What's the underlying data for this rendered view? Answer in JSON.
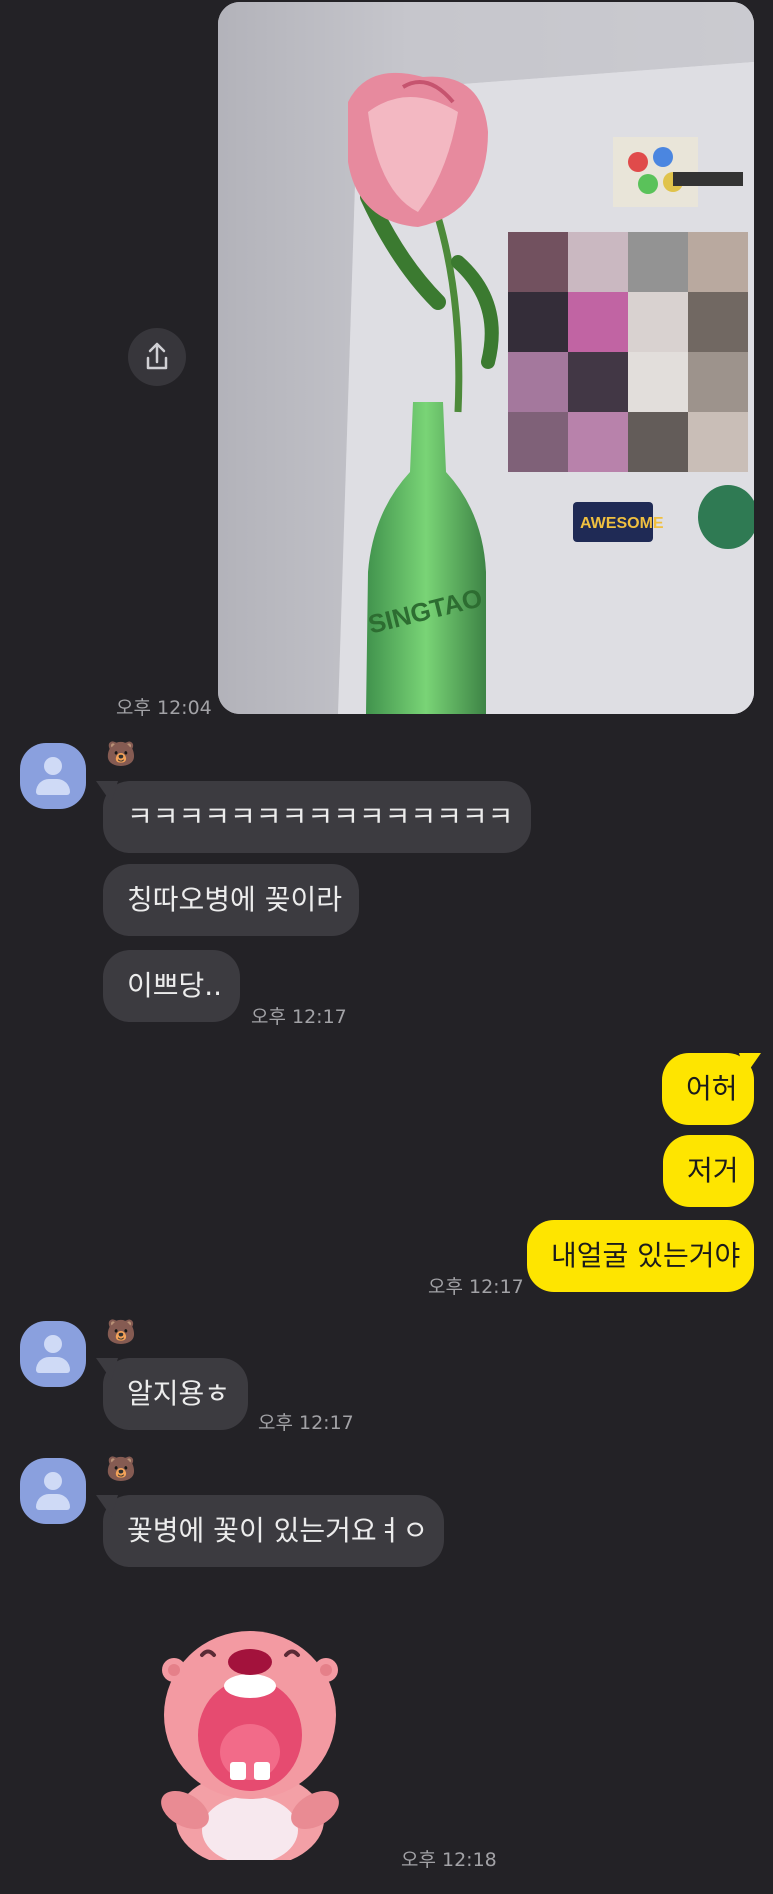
{
  "photo_message": {
    "time": "오후 12:04",
    "share_icon": "share-icon",
    "photo_text": [
      "AWESOME",
      "SINGTAO"
    ]
  },
  "group1": {
    "sender_emoji": "🐻",
    "messages": [
      "ㅋㅋㅋㅋㅋㅋㅋㅋㅋㅋㅋㅋㅋㅋㅋ",
      "칭따오병에 꽂이라",
      "이쁘당.."
    ],
    "time": "오후 12:17"
  },
  "outgoing": {
    "messages": [
      "어허",
      "저거",
      "내얼굴 있는거야"
    ],
    "time": "오후 12:17"
  },
  "group2": {
    "sender_emoji": "🐻",
    "message": "알지용ㅎ",
    "time": "오후 12:17"
  },
  "group3": {
    "sender_emoji": "🐻",
    "message": "꽃병에 꽃이 있는거요ㅕㅇ",
    "time": "오후 12:18",
    "sticker": "pink-beaver-sticker"
  },
  "colors": {
    "background": "#232226",
    "incoming_bubble": "#3c3b40",
    "outgoing_bubble": "#fee500",
    "avatar": "#8aa0de"
  }
}
